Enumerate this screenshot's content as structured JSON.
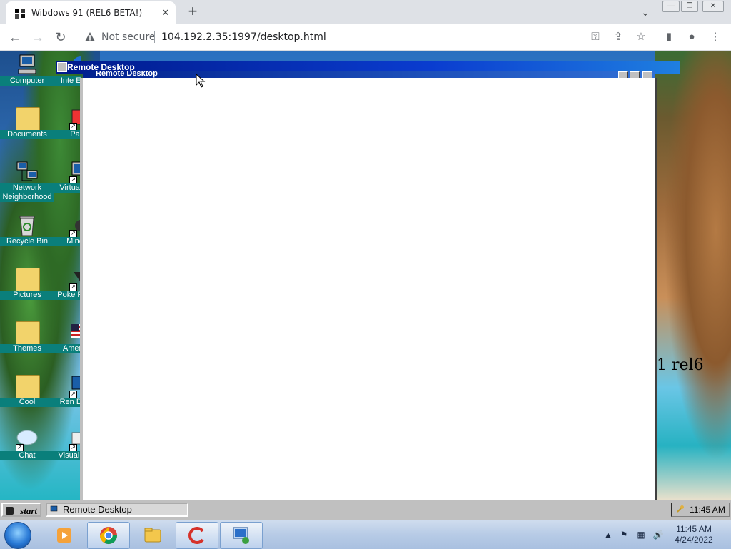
{
  "browser": {
    "tab_title": "Wibdows 91 (REL6 BETA!)",
    "new_tab_symbol": "+",
    "not_secure": "Not secure",
    "url": "104.192.2.35:1997/desktop.html"
  },
  "desktop": {
    "icons_col1": [
      {
        "label": "Computer",
        "icon": "computer-icon"
      },
      {
        "label": "Documents",
        "icon": "folder-icon"
      },
      {
        "label": "Network Neighborhood",
        "icon": "network-icon"
      },
      {
        "label": "Recycle Bin",
        "icon": "recycle-bin-icon"
      },
      {
        "label": "Pictures",
        "icon": "folder-icon"
      },
      {
        "label": "Themes",
        "icon": "folder-icon"
      },
      {
        "label": "Cool",
        "icon": "folder-icon"
      },
      {
        "label": "Chat",
        "icon": "chat-icon"
      }
    ],
    "icons_col2": [
      {
        "label": "Inte Exp",
        "icon": "internet-explorer-icon"
      },
      {
        "label": "Pa",
        "icon": "paint-icon"
      },
      {
        "label": "Virtual M",
        "icon": "virtual-machine-icon"
      },
      {
        "label": "Mine",
        "icon": "minesweeper-icon"
      },
      {
        "label": "Poke Plati",
        "icon": "pokemon-icon"
      },
      {
        "label": "Americ",
        "icon": "flag-icon"
      },
      {
        "label": "Ren Des",
        "icon": "remote-desktop-icon"
      },
      {
        "label": "Visual Co",
        "icon": "visual-code-icon"
      }
    ],
    "wallpaper_text": "1 rel6"
  },
  "remote_desktop": {
    "outer_title": "Remote Desktop",
    "inner_title": "Remote Desktop"
  },
  "w93_taskbar": {
    "start_label": "start",
    "task_label": "Remote Desktop",
    "tray_time": "11:45 AM"
  },
  "w7_taskbar": {
    "time": "11:45 AM",
    "date": "4/24/2022",
    "apps": [
      "media-player-icon",
      "chrome-icon",
      "explorer-icon",
      "ccleaner-icon",
      "remote-desktop-icon"
    ]
  },
  "colors": {
    "titlebar": "#0a3ccf",
    "desktop_label_bg": "#0a7f7b",
    "w93_gray": "#c0c0c0"
  }
}
